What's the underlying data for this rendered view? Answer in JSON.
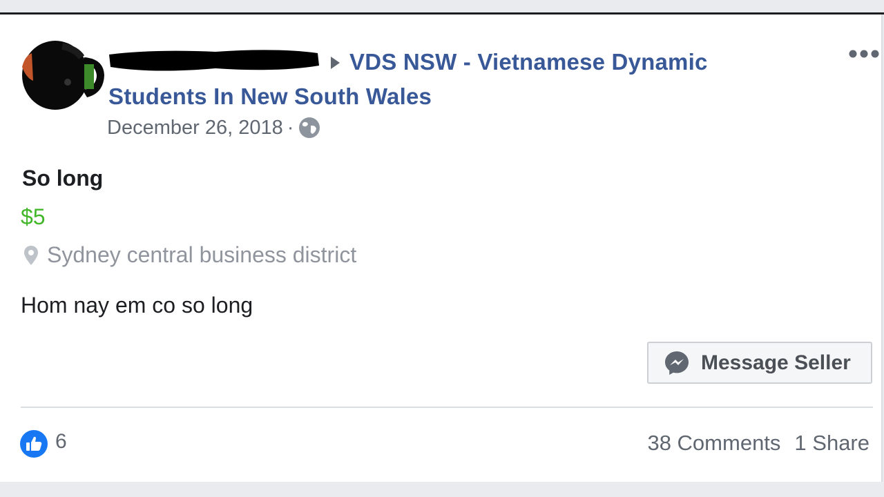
{
  "post": {
    "group_name": "VDS NSW - Vietnamese Dynamic Students In New South Wales",
    "date": "December 26, 2018",
    "separator": "·",
    "privacy_icon": "globe-icon",
    "more_icon": "more-options-icon",
    "author_redacted": true
  },
  "listing": {
    "title": "So long",
    "price": "$5",
    "location": "Sydney central business district",
    "location_icon": "map-pin-icon",
    "description": "Hom nay em co so long",
    "message_button_label": "Message Seller",
    "message_icon": "messenger-icon"
  },
  "footer": {
    "like_count": "6",
    "like_icon": "thumbs-up-icon",
    "comments": "38 Comments",
    "shares": "1 Share"
  },
  "colors": {
    "link": "#385898",
    "price": "#42b72a",
    "like": "#1877f2",
    "muted": "#90949c"
  }
}
